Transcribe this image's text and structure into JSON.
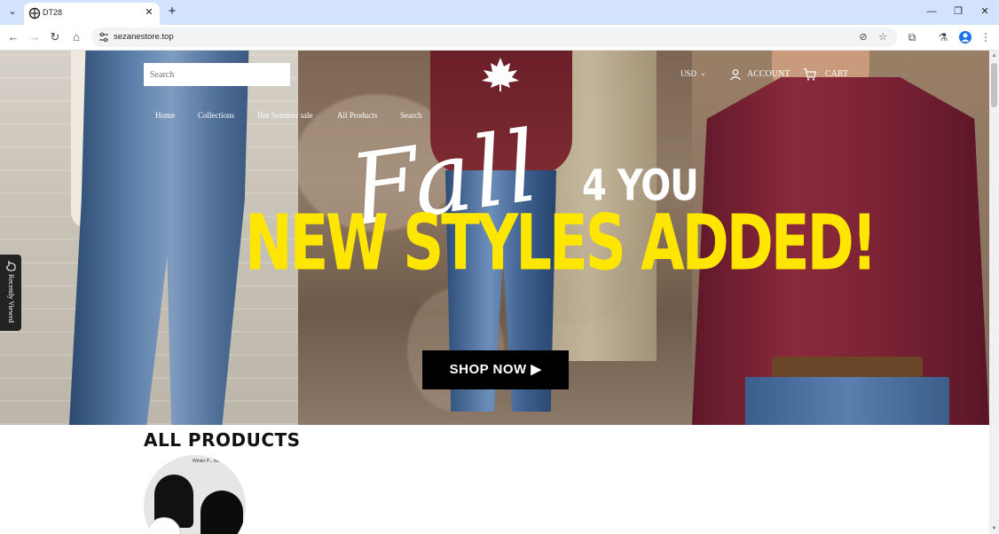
{
  "browser": {
    "tab_title": "DT28",
    "url": "sezanestore.top",
    "icons": {
      "tab_list": "chevron-down-icon",
      "favicon": "store-icon",
      "tab_close": "close-icon",
      "new_tab": "plus-icon",
      "minimize": "minimize-icon",
      "restore": "restore-icon",
      "close_window": "close-icon",
      "back": "back-arrow-icon",
      "forward": "forward-arrow-icon",
      "reload": "reload-icon",
      "home": "home-icon",
      "site_info": "tune-icon",
      "eye_off": "eye-off-icon",
      "bookmark": "star-icon",
      "extensions": "puzzle-icon",
      "labs": "flask-icon",
      "profile": "profile-icon",
      "menu": "kebab-menu-icon"
    }
  },
  "header": {
    "search_placeholder": "Search",
    "currency": "USD",
    "account_label": "ACCOUNT",
    "cart_label": "CART",
    "nav": [
      "Home",
      "Collections",
      "Hot Summer sale",
      "All Products",
      "Search"
    ]
  },
  "hero": {
    "script_text": "Fall",
    "sub_text": "4 YOU",
    "headline": "NEW STYLES ADDED!",
    "cta": "SHOP NOW ▶"
  },
  "recently_viewed": {
    "label": "Recently Viewed"
  },
  "products": {
    "section_title": "ALL PRODUCTS",
    "thumb_caption": "Winter P... Monster h..."
  },
  "colors": {
    "tabbar_bg": "#d3e3fd",
    "headline_yellow": "#ffe600",
    "cta_bg": "#000000"
  }
}
